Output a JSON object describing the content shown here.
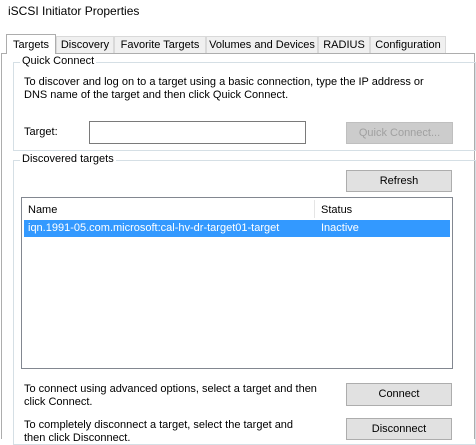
{
  "window": {
    "title": "iSCSI Initiator Properties"
  },
  "tabs": [
    {
      "label": "Targets",
      "active": true
    },
    {
      "label": "Discovery",
      "active": false
    },
    {
      "label": "Favorite Targets",
      "active": false
    },
    {
      "label": "Volumes and Devices",
      "active": false
    },
    {
      "label": "RADIUS",
      "active": false
    },
    {
      "label": "Configuration",
      "active": false
    }
  ],
  "quick_connect": {
    "legend": "Quick Connect",
    "description_line1": "To discover and log on to a target using a basic connection, type the IP address or",
    "description_line2": "DNS name of the target and then click Quick Connect.",
    "target_label": "Target:",
    "target_value": "",
    "button_label": "Quick Connect..."
  },
  "discovered": {
    "legend": "Discovered targets",
    "refresh_label": "Refresh",
    "columns": {
      "name": "Name",
      "status": "Status"
    },
    "rows": [
      {
        "name": "iqn.1991-05.com.microsoft:cal-hv-dr-target01-target",
        "status": "Inactive",
        "selected": true
      }
    ]
  },
  "advanced": {
    "text_line1": "To connect using advanced options, select a target and then",
    "text_line2": "click Connect.",
    "connect_label": "Connect"
  },
  "disconnect": {
    "text_line1": "To completely disconnect a target, select the target and",
    "text_line2": "then click Disconnect.",
    "disconnect_label": "Disconnect"
  },
  "colors": {
    "selection": "#3399ff",
    "accent_border": "#adadad"
  }
}
